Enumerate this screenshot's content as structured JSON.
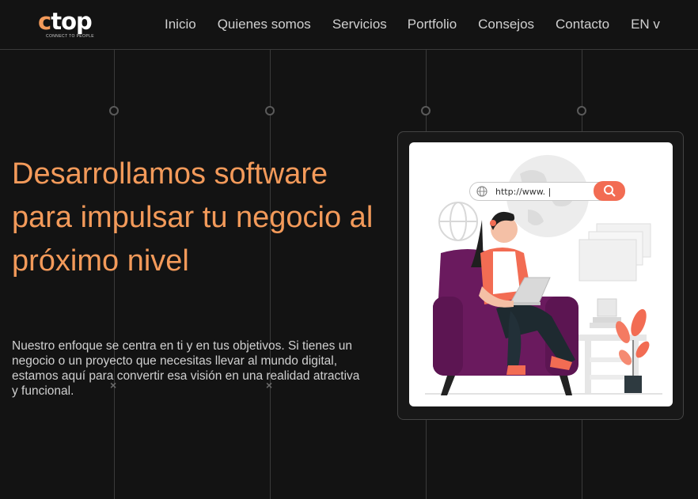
{
  "header": {
    "logo": {
      "word_accent": "c",
      "word_rest": "top",
      "tagline": "CONNECT TO PEOPLE"
    },
    "nav": [
      {
        "label": "Inicio"
      },
      {
        "label": "Quienes somos"
      },
      {
        "label": "Servicios"
      },
      {
        "label": "Portfolio"
      },
      {
        "label": "Consejos"
      },
      {
        "label": "Contacto"
      },
      {
        "label": "EN v"
      }
    ]
  },
  "hero": {
    "title": "Desarrollamos software para impulsar tu negocio al próximo nivel",
    "text": "Nuestro enfoque se centra en ti y en tus objetivos. Si tienes un negocio o un proyecto que necesitas llevar al mundo digital, estamos aquí para convertir esa visión en una realidad atractiva y funcional."
  },
  "illustration": {
    "url_text": "http://www. |",
    "icons": [
      "globe-icon",
      "search-icon"
    ]
  },
  "colors": {
    "background": "#131313",
    "accent": "#f39a5a",
    "search_button": "#f26c53",
    "chair": "#6a1a5e"
  }
}
